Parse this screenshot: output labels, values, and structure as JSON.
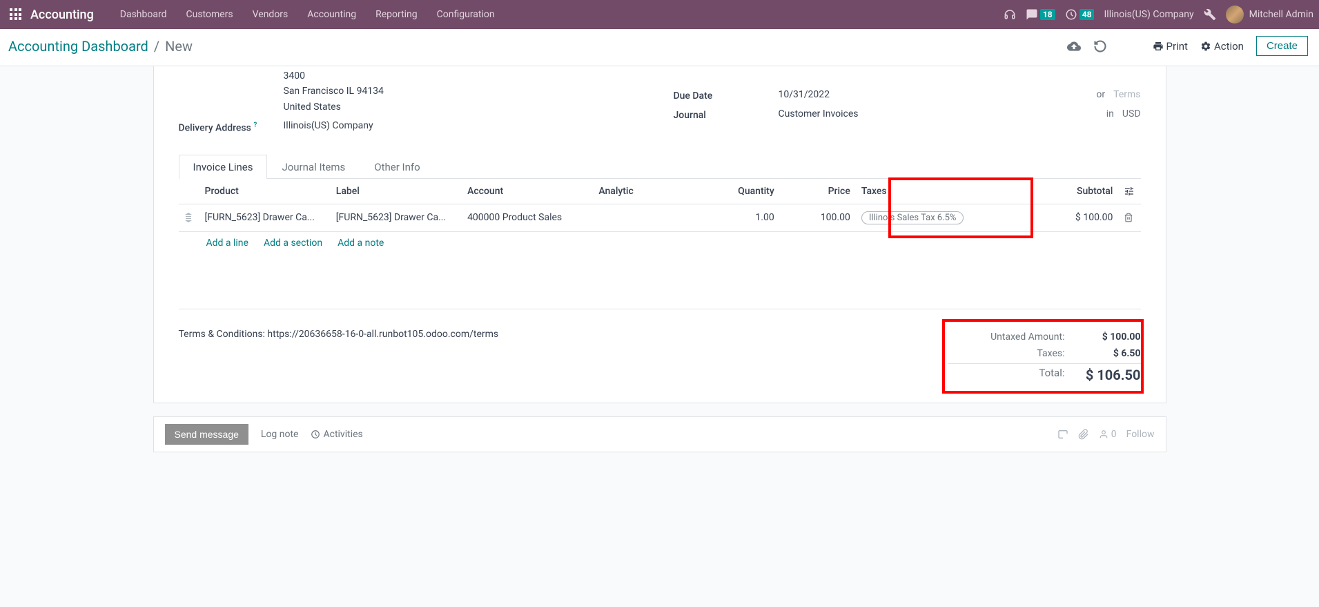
{
  "navbar": {
    "brand": "Accounting",
    "menu": [
      "Dashboard",
      "Customers",
      "Vendors",
      "Accounting",
      "Reporting",
      "Configuration"
    ],
    "messages_badge": "18",
    "activities_badge": "48",
    "company": "Illinois(US) Company",
    "user": "Mitchell Admin"
  },
  "breadcrumb": {
    "parent": "Accounting Dashboard",
    "current": "New"
  },
  "actions": {
    "print": "Print",
    "action": "Action",
    "create": "Create"
  },
  "partner": {
    "address_lines": [
      "3400",
      "San Francisco IL 94134",
      "United States"
    ]
  },
  "delivery": {
    "label": "Delivery Address",
    "help": "?",
    "value": "Illinois(US) Company"
  },
  "right_fields": {
    "due_date": {
      "label": "Due Date",
      "value": "10/31/2022",
      "or": "or",
      "terms_placeholder": "Terms"
    },
    "journal": {
      "label": "Journal",
      "value": "Customer Invoices",
      "in": "in",
      "currency": "USD"
    }
  },
  "tabs": [
    "Invoice Lines",
    "Journal Items",
    "Other Info"
  ],
  "table": {
    "headers": {
      "product": "Product",
      "label": "Label",
      "account": "Account",
      "analytic": "Analytic",
      "quantity": "Quantity",
      "price": "Price",
      "taxes": "Taxes",
      "subtotal": "Subtotal"
    },
    "rows": [
      {
        "product": "[FURN_5623] Drawer Ca...",
        "label": "[FURN_5623] Drawer Ca...",
        "account": "400000 Product Sales",
        "analytic": "",
        "quantity": "1.00",
        "price": "100.00",
        "taxes": "Illinois Sales Tax 6.5%",
        "subtotal": "$ 100.00"
      }
    ],
    "add_line": "Add a line",
    "add_section": "Add a section",
    "add_note": "Add a note"
  },
  "terms": "Terms & Conditions: https://20636658-16-0-all.runbot105.odoo.com/terms",
  "totals": {
    "untaxed_label": "Untaxed Amount:",
    "untaxed_value": "$ 100.00",
    "taxes_label": "Taxes:",
    "taxes_value": "$ 6.50",
    "total_label": "Total:",
    "total_value": "$ 106.50"
  },
  "chatter": {
    "send": "Send message",
    "log": "Log note",
    "activities": "Activities",
    "follower_count": "0",
    "follow": "Follow"
  }
}
